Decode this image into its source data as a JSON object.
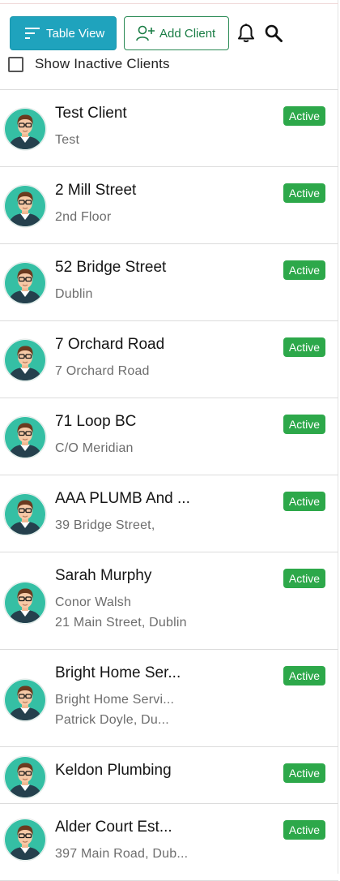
{
  "toolbar": {
    "table_view_label": "Table View",
    "add_client_label": "Add Client"
  },
  "filters": {
    "show_inactive_label": "Show Inactive Clients",
    "show_inactive_checked": false
  },
  "colors": {
    "primary": "#1fa3bd",
    "add_button_text": "#1a7d45",
    "active_badge": "#2da84a"
  },
  "clients": [
    {
      "name": "Test Client",
      "line1": "Test",
      "line2": "",
      "status": "Active"
    },
    {
      "name": "2 Mill Street",
      "line1": "2nd Floor",
      "line2": "",
      "status": "Active"
    },
    {
      "name": "52 Bridge Street",
      "line1": "Dublin",
      "line2": "",
      "status": "Active"
    },
    {
      "name": "7 Orchard Road",
      "line1": "7 Orchard Road",
      "line2": "",
      "status": "Active"
    },
    {
      "name": "71 Loop BC",
      "line1": "C/O Meridian",
      "line2": "",
      "status": "Active"
    },
    {
      "name": "AAA PLUMB And ...",
      "line1": "39 Bridge Street,",
      "line2": "",
      "status": "Active"
    },
    {
      "name": "Sarah Murphy",
      "line1": "Conor Walsh",
      "line2": "21 Main Street, Dublin",
      "status": "Active"
    },
    {
      "name": "Bright Home Ser...",
      "line1": "Bright Home Servi...",
      "line2": "Patrick Doyle, Du...",
      "status": "Active"
    },
    {
      "name": "Keldon Plumbing",
      "line1": "",
      "line2": "",
      "status": "Active"
    },
    {
      "name": "Alder Court Est...",
      "line1": "397 Main Road, Dub...",
      "line2": "",
      "status": "Active"
    }
  ]
}
